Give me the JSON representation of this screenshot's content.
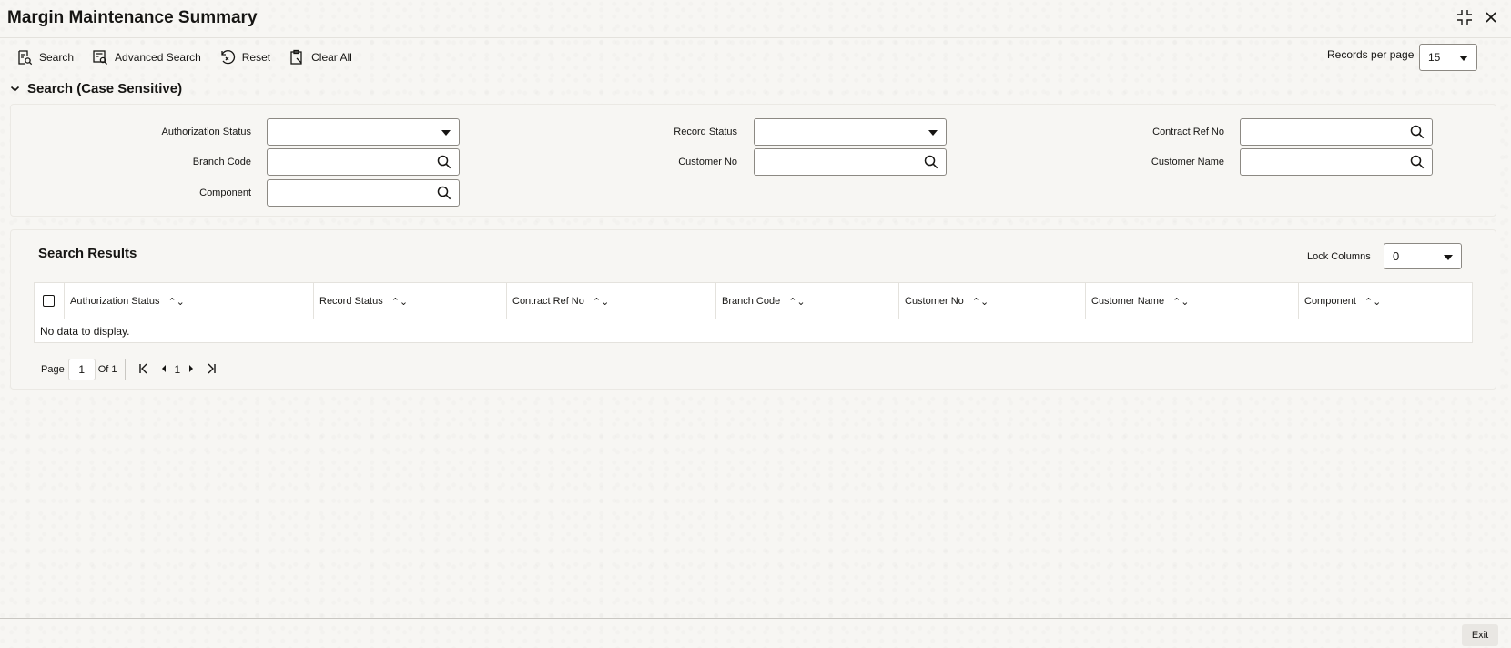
{
  "window": {
    "title": "Margin Maintenance Summary",
    "icons": [
      "collapse-icon",
      "close-icon"
    ]
  },
  "toolbar": {
    "search": "Search",
    "advanced_search": "Advanced Search",
    "reset": "Reset",
    "clear_all": "Clear All",
    "records_per_page_label": "Records per page",
    "records_per_page_value": "15"
  },
  "search": {
    "section_title": "Search (Case Sensitive)",
    "fields": {
      "authorization_status": {
        "label": "Authorization Status",
        "value": ""
      },
      "record_status": {
        "label": "Record Status",
        "value": ""
      },
      "contract_ref_no": {
        "label": "Contract Ref No",
        "value": ""
      },
      "branch_code": {
        "label": "Branch Code",
        "value": ""
      },
      "customer_no": {
        "label": "Customer No",
        "value": ""
      },
      "customer_name": {
        "label": "Customer Name",
        "value": ""
      },
      "component": {
        "label": "Component",
        "value": ""
      }
    }
  },
  "results": {
    "title": "Search Results",
    "lock_columns_label": "Lock Columns",
    "lock_columns_value": "0",
    "columns": [
      "Authorization Status",
      "Record Status",
      "Contract Ref No",
      "Branch Code",
      "Customer No",
      "Customer Name",
      "Component"
    ],
    "empty_message": "No data to display."
  },
  "pager": {
    "page_label": "Page",
    "current_page": "1",
    "of_label": "Of 1",
    "page_number": "1"
  },
  "footer": {
    "exit": "Exit"
  }
}
